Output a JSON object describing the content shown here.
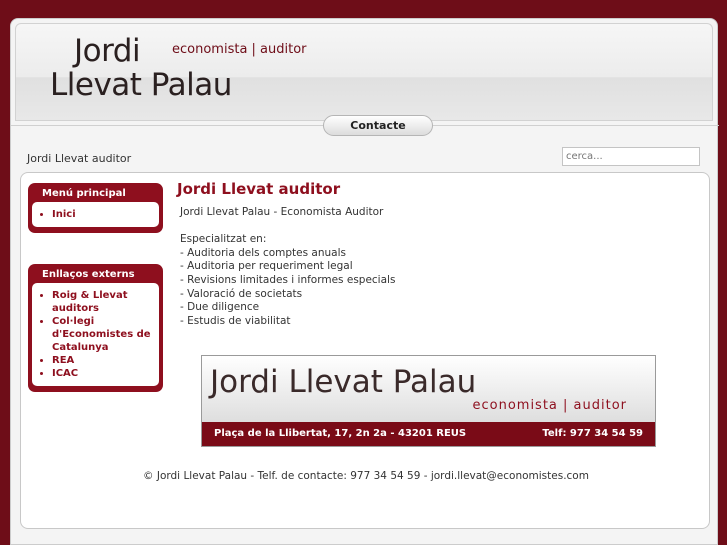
{
  "header": {
    "logo_line1": "Jordi",
    "logo_line2": "Llevat Palau",
    "tagline": "economista | auditor"
  },
  "nav": {
    "contact_tab": "Contacte"
  },
  "breadcrumb": "Jordi Llevat auditor",
  "search": {
    "placeholder": "cerca..."
  },
  "sidebar": {
    "main_menu": {
      "title": "Menú principal",
      "items": [
        "Inici"
      ]
    },
    "external_links": {
      "title": "Enllaços externs",
      "items": [
        "Roig & Llevat auditors",
        "Col·legi d'Economistes de Catalunya",
        "REA",
        "ICAC"
      ]
    }
  },
  "article": {
    "title": "Jordi Llevat auditor",
    "intro": "Jordi Llevat Palau - Economista Auditor",
    "specialized": "Especialitzat en:",
    "services": [
      "- Auditoria dels comptes anuals",
      "- Auditoria per requeriment legal",
      "- Revisions limitades i informes especials",
      "- Valoració de societats",
      "- Due diligence",
      "- Estudis de viabilitat"
    ]
  },
  "banner": {
    "name": "Jordi Llevat Palau",
    "subtitle": "economista | auditor",
    "address": "Plaça de la Llibertat, 17, 2n 2a - 43201 REUS",
    "phone": "Telf: 977 34 54 59"
  },
  "footer": "© Jordi Llevat Palau - Telf. de contacte: 977 34 54 59 - jordi.llevat@economistes.com"
}
